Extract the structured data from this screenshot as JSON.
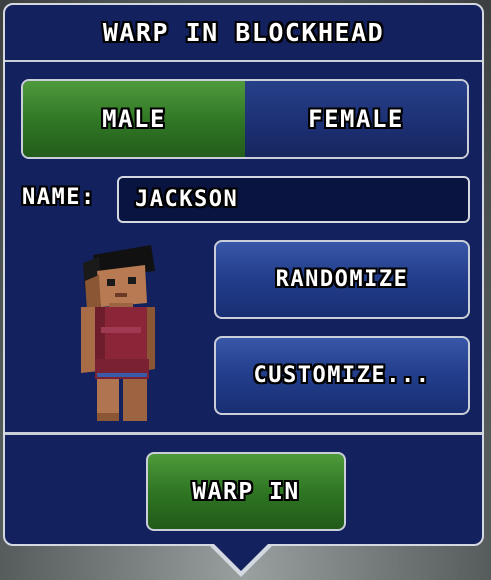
{
  "dialog": {
    "title": "WARP IN BLOCKHEAD"
  },
  "gender": {
    "options": [
      "MALE",
      "FEMALE"
    ],
    "selected": "MALE"
  },
  "name": {
    "label": "NAME:",
    "value": "JACKSON"
  },
  "buttons": {
    "randomize": "RANDOMIZE",
    "customize": "CUSTOMIZE...",
    "warp_in": "WARP IN"
  },
  "colors": {
    "panel": "#13215e",
    "selected_segment": "#2f7524",
    "button_blue": "#233f8d",
    "warp_button": "#2d7322",
    "border": "#d4d8e0"
  },
  "character_icon": "blockhead-character-preview"
}
